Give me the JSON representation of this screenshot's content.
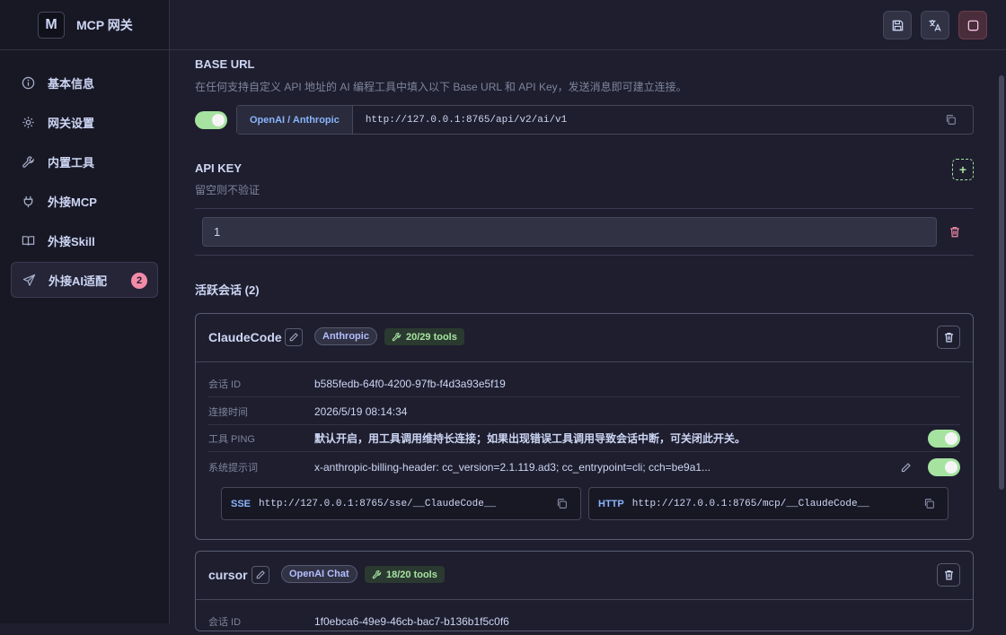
{
  "app": {
    "logo_letter": "M",
    "title": "MCP 网关"
  },
  "nav": [
    {
      "label": "基本信息",
      "icon": "info-icon"
    },
    {
      "label": "网关设置",
      "icon": "gear-icon"
    },
    {
      "label": "内置工具",
      "icon": "wrench-icon"
    },
    {
      "label": "外接MCP",
      "icon": "plug-icon"
    },
    {
      "label": "外接Skill",
      "icon": "book-icon"
    },
    {
      "label": "外接AI适配",
      "icon": "send-icon",
      "active": true,
      "badge": "2"
    }
  ],
  "base_url": {
    "title": "BASE URL",
    "desc": "在任何支持自定义 API 地址的 AI 编程工具中填入以下 Base URL 和 API Key，发送消息即可建立连接。",
    "enabled": true,
    "tag": "OpenAI / Anthropic",
    "url": "http://127.0.0.1:8765/api/v2/ai/v1"
  },
  "api_key": {
    "title": "API KEY",
    "desc": "留空则不验证",
    "value": "1"
  },
  "sessions": {
    "title": "活跃会话",
    "count_text": "(2)",
    "items": [
      {
        "name": "ClaudeCode",
        "provider": "Anthropic",
        "tools": "20/29 tools",
        "session_id_label": "会话 ID",
        "session_id": "b585fedb-64f0-4200-97fb-f4d3a93e5f19",
        "connected_label": "连接时间",
        "connected_at": "2026/5/19 08:14:34",
        "ping_label": "工具 PING",
        "ping_desc": "默认开启，用工具调用维持长连接；如果出现错误工具调用导致会话中断，可关闭此开关。",
        "ping_enabled": true,
        "prompt_label": "系统提示词",
        "prompt_value": "x-anthropic-billing-header: cc_version=2.1.119.ad3; cc_entrypoint=cli; cch=be9a1...",
        "prompt_enabled": true,
        "sse_label": "SSE",
        "sse_url": "http://127.0.0.1:8765/sse/__ClaudeCode__",
        "http_label": "HTTP",
        "http_url": "http://127.0.0.1:8765/mcp/__ClaudeCode__"
      },
      {
        "name": "cursor",
        "provider": "OpenAI Chat",
        "tools": "18/20 tools",
        "session_id_label": "会话 ID",
        "session_id": "1f0ebca6-49e9-46cb-bac7-b136b1f5c0f6"
      }
    ]
  },
  "colors": {
    "accent": "#89b4fa",
    "toggle_on": "#a6e3a1",
    "danger": "#f38ba8",
    "background": "#1e1e2e"
  }
}
